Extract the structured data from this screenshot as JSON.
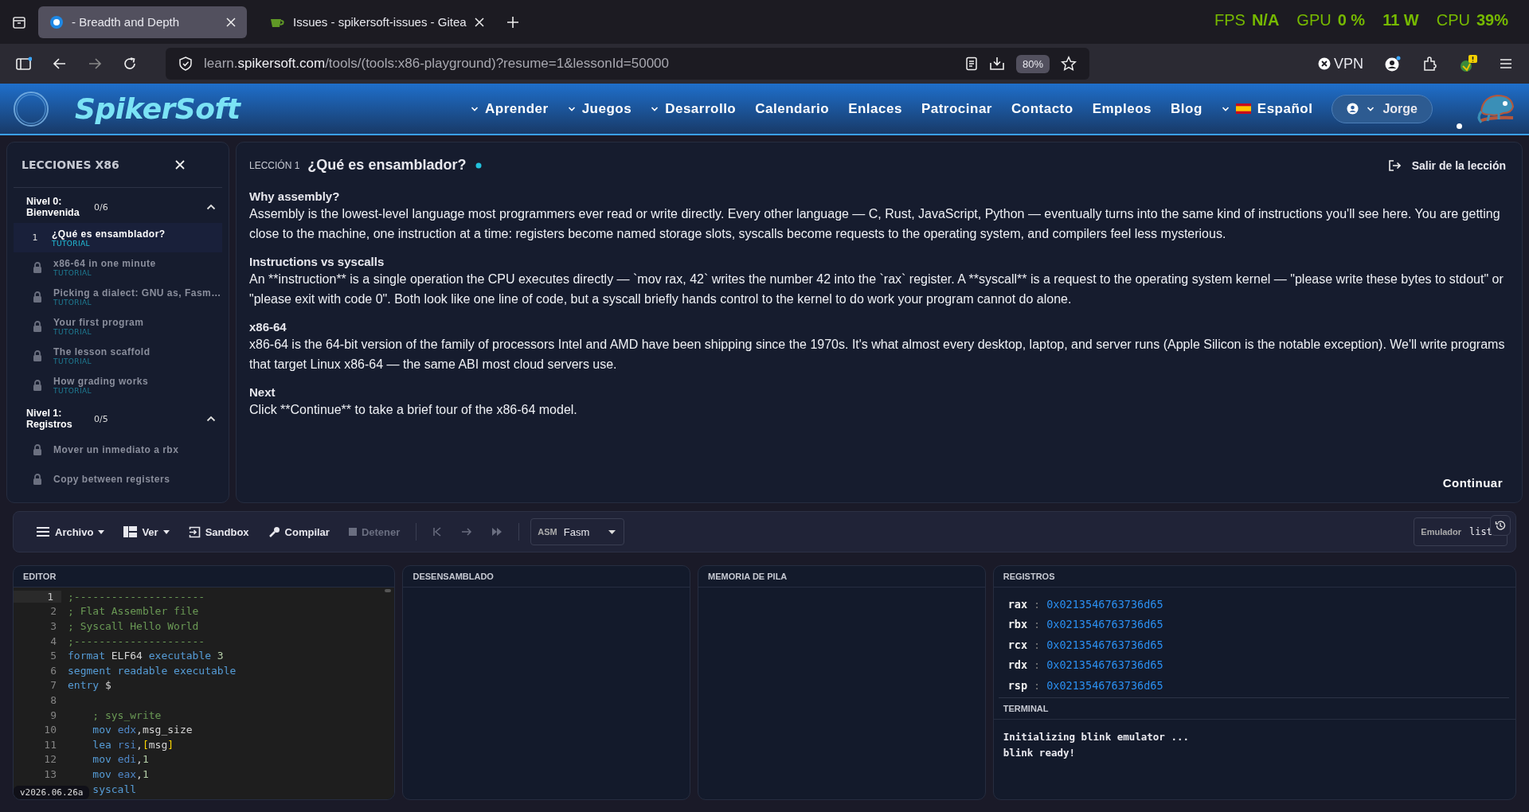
{
  "browser": {
    "tabs": [
      {
        "title": "- Breadth and Depth",
        "selected": true
      },
      {
        "title": "Issues - spikersoft-issues - Gitea",
        "selected": false
      }
    ],
    "overlay": [
      {
        "label": "FPS",
        "value": "N/A"
      },
      {
        "label": "GPU",
        "value": "0 %"
      },
      {
        "value": "11 W"
      },
      {
        "label": "CPU",
        "value": "39%"
      }
    ],
    "url": {
      "subdomain": "learn.",
      "domain": "spikersoft.com",
      "path": "/tools/(tools:x86-playground)?resume=1&lessonId=50000"
    },
    "zoom": "80%",
    "vpn": "VPN"
  },
  "site": {
    "logo": "SpikerSoft",
    "nav": [
      {
        "label": "Aprender",
        "dropdown": true
      },
      {
        "label": "Juegos",
        "dropdown": true
      },
      {
        "label": "Desarrollo",
        "dropdown": true
      },
      {
        "label": "Calendario",
        "dropdown": false
      },
      {
        "label": "Enlaces",
        "dropdown": false
      },
      {
        "label": "Patrocinar",
        "dropdown": false
      },
      {
        "label": "Contacto",
        "dropdown": false
      },
      {
        "label": "Empleos",
        "dropdown": false
      },
      {
        "label": "Blog",
        "dropdown": false
      }
    ],
    "language": "Español",
    "user": "Jorge"
  },
  "sidebar": {
    "title": "LECCIONES X86",
    "levels": [
      {
        "name": "Nivel 0: Bienvenida",
        "progress": "0/6",
        "expanded": true,
        "lessons": [
          {
            "number": "1",
            "title": "¿Qué es ensamblador?",
            "tag": "TUTORIAL",
            "locked": false,
            "selected": true
          },
          {
            "title": "x86-64 in one minute",
            "tag": "TUTORIAL",
            "locked": true,
            "selected": false
          },
          {
            "title": "Picking a dialect: GNU as, Fasm…",
            "tag": "TUTORIAL",
            "locked": true,
            "selected": false
          },
          {
            "title": "Your first program",
            "tag": "TUTORIAL",
            "locked": true,
            "selected": false
          },
          {
            "title": "The lesson scaffold",
            "tag": "TUTORIAL",
            "locked": true,
            "selected": false
          },
          {
            "title": "How grading works",
            "tag": "TUTORIAL",
            "locked": true,
            "selected": false
          }
        ]
      },
      {
        "name": "Nivel 1: Registros",
        "progress": "0/5",
        "expanded": true,
        "lessons": [
          {
            "title": "Mover un inmediato a rbx",
            "locked": true,
            "selected": false
          },
          {
            "title": "Copy between registers",
            "locked": true,
            "selected": false
          }
        ]
      }
    ]
  },
  "lesson": {
    "label": "LECCIÓN 1",
    "title": "¿Qué es ensamblador?",
    "exit": "Salir de la lección",
    "sections": [
      {
        "heading": "Why assembly?",
        "text": "Assembly is the lowest-level language most programmers ever read or write directly. Every other language — C, Rust, JavaScript, Python — eventually turns into the same kind of instructions you'll see here. You are getting close to the machine, one instruction at a time: registers become named storage slots, syscalls become requests to the operating system, and compilers feel less mysterious."
      },
      {
        "heading": "Instructions vs syscalls",
        "text": "An **instruction** is a single operation the CPU executes directly — `mov rax, 42` writes the number 42 into the `rax` register. A **syscall** is a request to the operating system kernel — \"please write these bytes to stdout\" or \"please exit with code 0\". Both look like one line of code, but a syscall briefly hands control to the kernel to do work your program cannot do alone."
      },
      {
        "heading": "x86-64",
        "text": "x86-64 is the 64-bit version of the family of processors Intel and AMD have been shipping since the 1970s. It's what almost every desktop, laptop, and server runs (Apple Silicon is the notable exception). We'll write programs that target Linux x86-64 — the same ABI most cloud servers use."
      },
      {
        "heading": "Next",
        "text": "Click **Continue** to take a brief tour of the x86-64 model."
      }
    ],
    "continue": "Continuar"
  },
  "toolbar": {
    "items": [
      {
        "kind": "menu",
        "label": "Archivo",
        "disabled": false
      },
      {
        "kind": "layout",
        "label": "Ver",
        "disabled": false
      },
      {
        "kind": "sandbox",
        "label": "Sandbox",
        "disabled": false
      },
      {
        "kind": "compile",
        "label": "Compilar",
        "disabled": false
      },
      {
        "kind": "stop",
        "label": "Detener",
        "disabled": true
      },
      {
        "kind": "first",
        "disabled": true
      },
      {
        "kind": "step",
        "disabled": true
      },
      {
        "kind": "run",
        "disabled": true
      }
    ],
    "assembler": {
      "prefix": "ASM",
      "value": "Fasm"
    },
    "status": {
      "label": "Emulador",
      "value": "list"
    }
  },
  "panels": {
    "editor": {
      "title": "EDITOR",
      "lines": [
        {
          "number": "1",
          "tokens": [
            {
              "kind": "comment",
              "text": ";---------------------"
            }
          ]
        },
        {
          "number": "2",
          "tokens": [
            {
              "kind": "comment",
              "text": "; Flat Assembler file"
            }
          ]
        },
        {
          "number": "3",
          "tokens": [
            {
              "kind": "comment",
              "text": "; Syscall Hello World"
            }
          ]
        },
        {
          "number": "4",
          "tokens": [
            {
              "kind": "comment",
              "text": ";---------------------"
            }
          ]
        },
        {
          "number": "5",
          "tokens": [
            {
              "kind": "keyword",
              "text": "format "
            },
            {
              "kind": "plain",
              "text": "ELF64 "
            },
            {
              "kind": "keyword",
              "text": "executable "
            },
            {
              "kind": "number",
              "text": "3"
            }
          ]
        },
        {
          "number": "6",
          "tokens": [
            {
              "kind": "keyword",
              "text": "segment readable executable"
            }
          ]
        },
        {
          "number": "7",
          "tokens": [
            {
              "kind": "keyword",
              "text": "entry "
            },
            {
              "kind": "plain",
              "text": "$"
            }
          ]
        },
        {
          "number": "8"
        },
        {
          "number": "9",
          "tokens": [
            {
              "kind": "comment",
              "text": "    ; sys_write"
            }
          ]
        },
        {
          "number": "10",
          "tokens": [
            {
              "kind": "keyword",
              "text": "    mov "
            },
            {
              "kind": "register",
              "text": "edx"
            },
            {
              "kind": "plain",
              "text": ",msg_size"
            }
          ]
        },
        {
          "number": "11",
          "tokens": [
            {
              "kind": "keyword",
              "text": "    lea "
            },
            {
              "kind": "register",
              "text": "rsi"
            },
            {
              "kind": "plain",
              "text": ","
            },
            {
              "kind": "bracket",
              "text": "["
            },
            {
              "kind": "plain",
              "text": "msg"
            },
            {
              "kind": "bracket",
              "text": "]"
            }
          ]
        },
        {
          "number": "12",
          "tokens": [
            {
              "kind": "keyword",
              "text": "    mov "
            },
            {
              "kind": "register",
              "text": "edi"
            },
            {
              "kind": "plain",
              "text": ","
            },
            {
              "kind": "number",
              "text": "1"
            }
          ]
        },
        {
          "number": "13",
          "tokens": [
            {
              "kind": "keyword",
              "text": "    mov "
            },
            {
              "kind": "register",
              "text": "eax"
            },
            {
              "kind": "plain",
              "text": ","
            },
            {
              "kind": "number",
              "text": "1"
            }
          ]
        },
        {
          "tokens": [
            {
              "kind": "keyword",
              "text": "    syscall"
            }
          ]
        }
      ],
      "version": "v2026.06.26a"
    },
    "disassembly": {
      "title": "DESENSAMBLADO"
    },
    "stack": {
      "title": "MEMORIA DE PILA"
    },
    "registers": {
      "title": "REGISTROS",
      "rows": [
        {
          "name": "rax",
          "separator": ":",
          "value": "0x0213546763736d65"
        },
        {
          "name": "rbx",
          "separator": ":",
          "value": "0x0213546763736d65"
        },
        {
          "name": "rcx",
          "separator": ":",
          "value": "0x0213546763736d65"
        },
        {
          "name": "rdx",
          "separator": ":",
          "value": "0x0213546763736d65"
        },
        {
          "name": "rsp",
          "separator": ":",
          "value": "0x0213546763736d65"
        }
      ]
    },
    "terminal": {
      "title": "TERMINAL",
      "lines": [
        "Initializing blink emulator ...",
        "blink ready!"
      ]
    }
  }
}
